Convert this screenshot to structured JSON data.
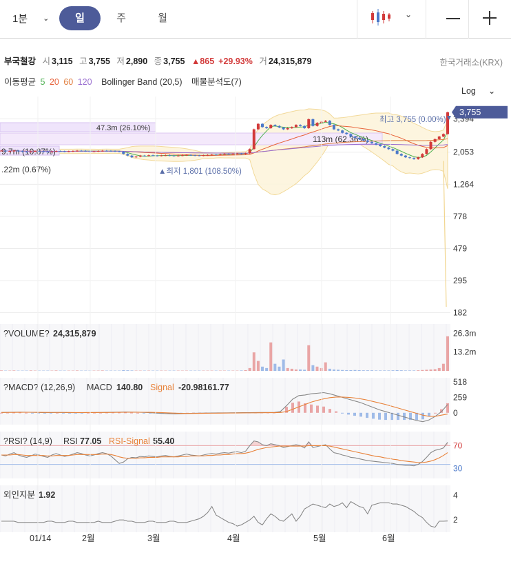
{
  "toolbar": {
    "interval": "1분",
    "tabs": [
      "일",
      "주",
      "월"
    ],
    "active_tab": "일",
    "colors": {
      "active_tab_bg": "#4d5b99"
    }
  },
  "quote": {
    "name": "부국철강",
    "open_label": "시",
    "open": "3,115",
    "high_label": "고",
    "high": "3,755",
    "low_label": "저",
    "low": "2,890",
    "close_label": "종",
    "close": "3,755",
    "change": "▲865",
    "change_pct": "+29.93%",
    "volume_label": "거",
    "volume": "24,315,879",
    "exchange": "한국거래소(KRX)"
  },
  "indicators": {
    "ma_label": "이동평균",
    "ma_periods": [
      "5",
      "20",
      "60",
      "120"
    ],
    "ma_colors": [
      "#4caf50",
      "#e8623a",
      "#e07c3c",
      "#9a6fd0"
    ],
    "bollinger": "Bollinger Band (20,5)",
    "volume_profile": "매물분석도(7)",
    "scale": "Log"
  },
  "chart_data": [
    {
      "type": "candlestick",
      "scale": "log",
      "y_ticks": [
        "3,394",
        "2,053",
        "1,264",
        "778",
        "479",
        "295",
        "182"
      ],
      "last_price_tag": "3,755",
      "annotations": {
        "high": "최고 3,755 (0.00%)",
        "low": "▲최저 1,801 (108.50%)",
        "profile": [
          "47.3m (26.10%)",
          "113m (62.36%)",
          "9.7m (10.87%)",
          ".22m (0.67%)"
        ]
      },
      "x_ticks": [
        "01/14",
        "2월",
        "3월",
        "4월",
        "5월",
        "6월"
      ],
      "close_series": [
        2100,
        2080,
        2090,
        2100,
        2085,
        2070,
        2060,
        2075,
        2090,
        2080,
        2070,
        2060,
        2075,
        2085,
        2080,
        2070,
        2080,
        2090,
        2100,
        2095,
        2085,
        2075,
        2080,
        2090,
        2100,
        2095,
        2090,
        2080,
        2070,
        2000,
        1950,
        1900,
        1920,
        1950,
        1940,
        1960,
        1950,
        1945,
        1955,
        1960,
        1950,
        1940,
        1950,
        1960,
        1970,
        1960,
        1955,
        1950,
        1960,
        1970,
        1980,
        1975,
        1990,
        2000,
        1995,
        2005,
        2010,
        2000,
        2020,
        2150,
        2900,
        3150,
        3000,
        2950,
        3100,
        3050,
        2980,
        2900,
        2950,
        3000,
        3100,
        3050,
        2950,
        3380,
        3050,
        3200,
        3250,
        3300,
        3100,
        2900,
        2850,
        2750,
        2700,
        2600,
        2550,
        2500,
        2450,
        2400,
        2350,
        2300,
        2250,
        2200,
        2150,
        2100,
        2000,
        1950,
        1900,
        1880,
        1850,
        1900,
        2000,
        2150,
        2400,
        2500,
        2600,
        2700,
        3750
      ]
    },
    {
      "type": "bar",
      "title": "?VOLUME?",
      "value": "24,315,879",
      "y_ticks": [
        "26.3m",
        "13.2m"
      ],
      "values_m": [
        0.3,
        0.2,
        0.2,
        0.3,
        0.2,
        0.2,
        0.2,
        0.3,
        0.2,
        0.2,
        0.2,
        0.2,
        0.2,
        0.3,
        0.2,
        0.2,
        0.2,
        0.2,
        0.3,
        0.2,
        0.2,
        0.2,
        0.2,
        0.2,
        0.3,
        0.2,
        0.2,
        0.2,
        0.2,
        0.5,
        0.4,
        0.3,
        0.2,
        0.2,
        0.2,
        0.2,
        0.2,
        0.2,
        0.2,
        0.2,
        0.2,
        0.2,
        0.2,
        0.2,
        0.2,
        0.2,
        0.2,
        0.2,
        0.2,
        0.2,
        0.2,
        0.2,
        0.2,
        0.2,
        0.2,
        0.2,
        0.2,
        0.3,
        0.5,
        2.0,
        13.0,
        7.0,
        3.0,
        2.0,
        20.0,
        5.0,
        3.0,
        8.0,
        2.0,
        1.5,
        1.0,
        1.0,
        0.8,
        18.0,
        4.0,
        3.0,
        2.0,
        6.0,
        1.5,
        1.0,
        0.8,
        0.6,
        0.5,
        0.5,
        0.6,
        0.5,
        0.4,
        0.4,
        0.4,
        0.3,
        0.3,
        0.3,
        0.3,
        0.4,
        0.5,
        0.4,
        0.3,
        0.3,
        0.3,
        0.4,
        0.6,
        0.8,
        1.0,
        1.2,
        2.0,
        5.0,
        24.3
      ]
    },
    {
      "type": "line",
      "title": "?MACD? (12,26,9)",
      "macd_label": "MACD",
      "macd_value": "140.80",
      "signal_label": "Signal",
      "signal_value": "-20.98161.77",
      "y_ticks": [
        "518",
        "259",
        "0"
      ],
      "series": [
        {
          "name": "MACD",
          "color": "#888888",
          "values": [
            5,
            8,
            10,
            12,
            10,
            8,
            5,
            3,
            4,
            6,
            5,
            3,
            2,
            3,
            4,
            5,
            6,
            8,
            10,
            12,
            14,
            12,
            10,
            6,
            2,
            -5,
            -10,
            -15,
            -18,
            -15,
            -10,
            -8,
            -6,
            -4,
            -3,
            -2,
            -1,
            0,
            1,
            2,
            3,
            4,
            5,
            5,
            6,
            20,
            120,
            230,
            290,
            300,
            320,
            330,
            340,
            320,
            290,
            260,
            230,
            200,
            170,
            130,
            90,
            50,
            20,
            -10,
            -40,
            -70,
            -100,
            -130,
            -150,
            -120,
            -60,
            20,
            140
          ]
        },
        {
          "name": "Signal",
          "color": "#e8823a",
          "values": [
            5,
            6,
            7,
            8,
            9,
            9,
            8,
            7,
            6,
            6,
            6,
            5,
            4,
            4,
            4,
            4,
            5,
            5,
            6,
            8,
            9,
            10,
            10,
            9,
            8,
            5,
            2,
            -2,
            -6,
            -9,
            -10,
            -10,
            -9,
            -8,
            -7,
            -6,
            -5,
            -4,
            -3,
            -2,
            -1,
            0,
            1,
            2,
            3,
            5,
            20,
            60,
            100,
            140,
            180,
            210,
            235,
            255,
            265,
            265,
            260,
            250,
            235,
            215,
            190,
            165,
            140,
            110,
            80,
            50,
            20,
            -10,
            -40,
            -60,
            -60,
            -40,
            -21
          ]
        }
      ]
    },
    {
      "type": "line",
      "title": "?RSI? (14,9)",
      "rsi_label": "RSI",
      "rsi_value": "77.05",
      "signal_label": "RSI-Signal",
      "signal_value": "55.40",
      "y_ticks": [
        "70",
        "30"
      ],
      "series": [
        {
          "name": "RSI",
          "color": "#888888",
          "values": [
            50,
            48,
            52,
            55,
            50,
            47,
            45,
            48,
            52,
            50,
            47,
            45,
            50,
            53,
            50,
            47,
            49,
            52,
            55,
            53,
            50,
            48,
            50,
            53,
            55,
            53,
            48,
            40,
            32,
            35,
            42,
            45,
            44,
            47,
            46,
            48,
            47,
            46,
            48,
            49,
            47,
            46,
            48,
            50,
            52,
            50,
            49,
            48,
            50,
            52,
            53,
            52,
            54,
            55,
            54,
            56,
            57,
            55,
            58,
            70,
            80,
            78,
            72,
            70,
            74,
            72,
            70,
            66,
            68,
            70,
            72,
            70,
            65,
            78,
            66,
            68,
            70,
            72,
            63,
            55,
            53,
            50,
            48,
            45,
            44,
            42,
            40,
            38,
            37,
            36,
            35,
            34,
            33,
            32,
            30,
            29,
            28,
            28,
            27,
            30,
            36,
            45,
            55,
            60,
            62,
            65,
            77
          ]
        },
        {
          "name": "RSI-Signal",
          "color": "#e8823a",
          "values": [
            50,
            50,
            50,
            51,
            51,
            50,
            49,
            49,
            49,
            49,
            49,
            48,
            48,
            49,
            49,
            49,
            49,
            50,
            51,
            51,
            51,
            51,
            51,
            51,
            52,
            52,
            51,
            49,
            46,
            44,
            43,
            43,
            43,
            44,
            44,
            45,
            45,
            45,
            46,
            46,
            46,
            46,
            46,
            47,
            47,
            48,
            48,
            48,
            48,
            49,
            49,
            50,
            50,
            51,
            51,
            52,
            53,
            53,
            54,
            56,
            59,
            62,
            64,
            66,
            67,
            68,
            69,
            69,
            69,
            69,
            69,
            69,
            69,
            70,
            70,
            70,
            70,
            70,
            69,
            67,
            65,
            63,
            61,
            59,
            57,
            55,
            53,
            51,
            49,
            47,
            46,
            44,
            43,
            41,
            40,
            38,
            37,
            36,
            35,
            34,
            34,
            35,
            37,
            40,
            44,
            49,
            55
          ]
        }
      ]
    },
    {
      "type": "line",
      "title": "외인지분",
      "value": "1.92",
      "y_ticks": [
        "4",
        "2"
      ],
      "series": [
        {
          "name": "외인지분",
          "color": "#888888",
          "values": [
            1.9,
            1.9,
            1.9,
            1.9,
            1.8,
            1.8,
            1.8,
            1.8,
            1.8,
            1.8,
            1.8,
            1.9,
            1.9,
            1.8,
            1.8,
            1.8,
            1.9,
            1.9,
            1.8,
            1.8,
            1.8,
            1.8,
            1.8,
            1.9,
            1.8,
            1.8,
            1.8,
            1.9,
            2.0,
            2.0,
            1.9,
            1.9,
            1.8,
            1.8,
            1.8,
            1.9,
            1.9,
            1.8,
            1.8,
            1.8,
            1.9,
            1.9,
            1.8,
            1.8,
            1.8,
            1.9,
            2.0,
            2.1,
            2.3,
            2.6,
            3.1,
            2.4,
            2.2,
            2.0,
            1.8,
            1.7,
            1.5,
            1.6,
            1.8,
            2.0,
            2.3,
            1.8,
            1.6,
            2.1,
            2.5,
            2.3,
            2.0,
            1.9,
            2.2,
            2.5,
            1.9,
            2.3,
            2.9,
            3.1,
            3.3,
            3.2,
            3.1,
            3.0,
            3.3,
            3.1,
            3.2,
            3.4,
            3.0,
            3.5,
            3.3,
            3.1,
            3.0,
            2.5,
            3.2,
            3.3,
            3.4,
            3.4,
            3.4,
            3.3,
            3.3,
            3.2,
            3.1,
            2.9,
            2.7,
            2.4,
            2.2,
            1.8,
            1.5,
            1.4,
            1.9,
            1.9,
            1.92
          ]
        }
      ]
    }
  ]
}
